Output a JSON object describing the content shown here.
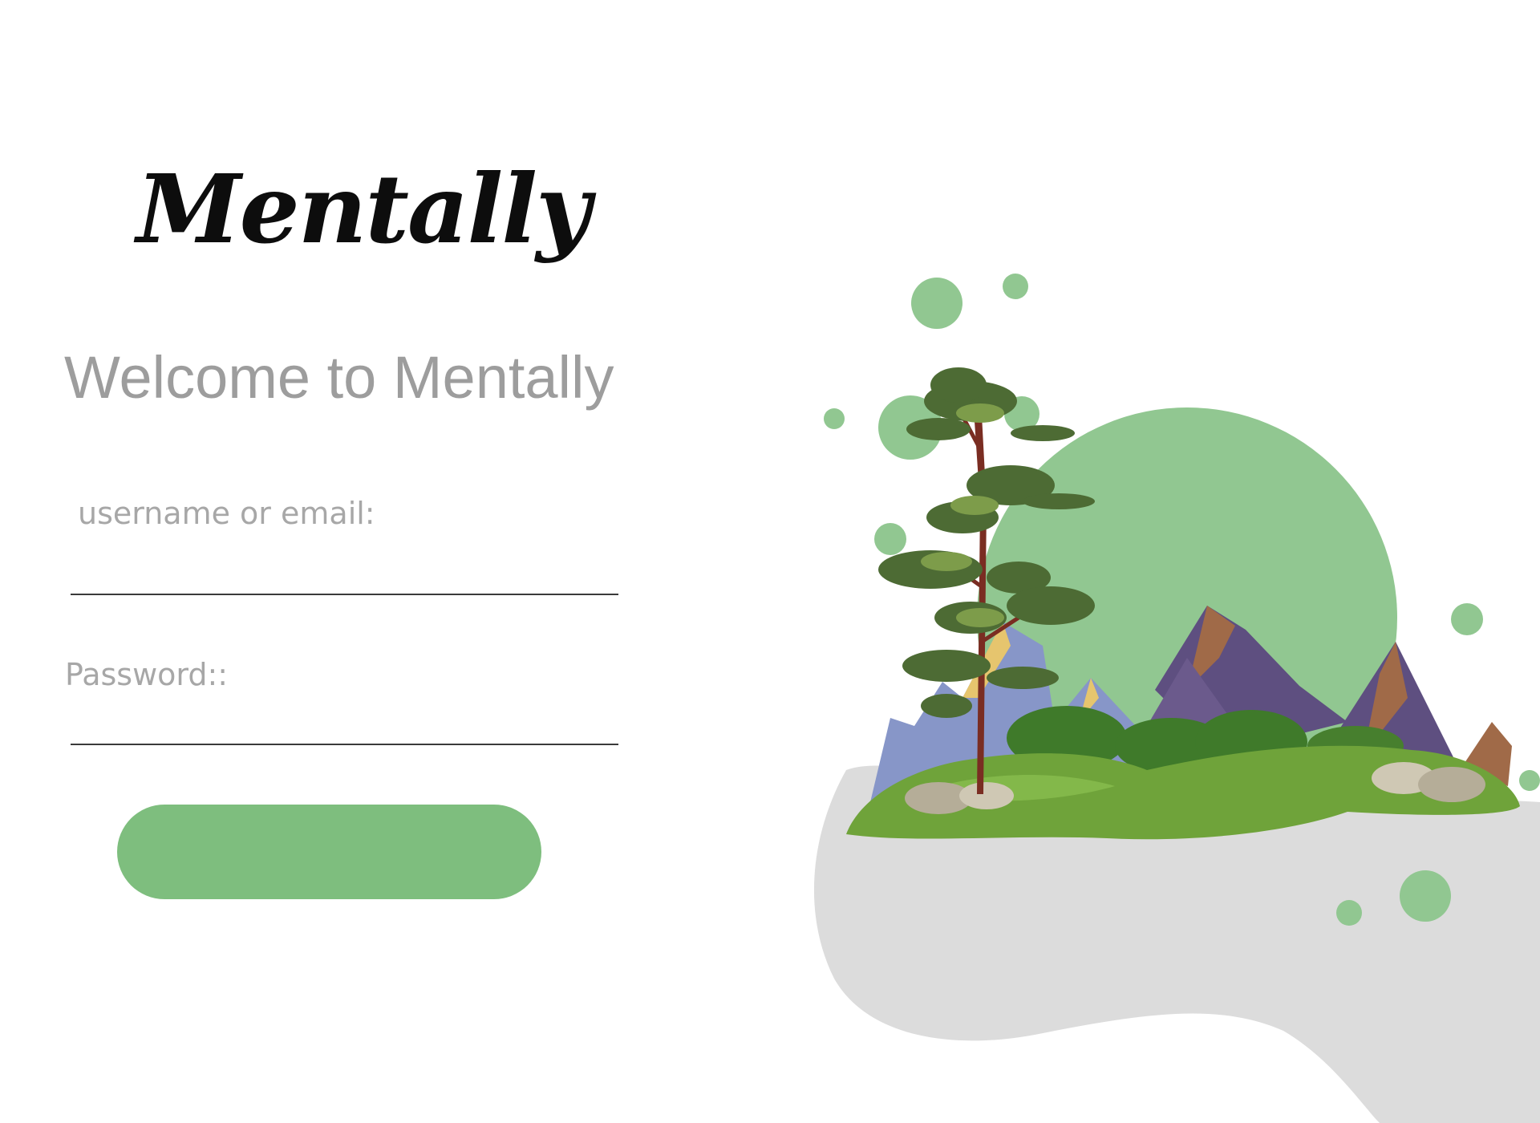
{
  "app": {
    "logo_text": "Mentally"
  },
  "login": {
    "welcome_text": "Welcome to Mentally",
    "username_label": "username or email:",
    "username_value": "",
    "password_label": "Password::",
    "password_value": "",
    "submit_label": ""
  },
  "illustration": {
    "icon": "nature-landscape-illustration",
    "colors": {
      "accent_green": "#7ebe7e",
      "bubble_green": "#91c791",
      "blob_grey": "#dcdcdc",
      "grass": "#6fa33a",
      "mountain_blue": "#8796c8",
      "mountain_purple": "#5e4f80",
      "mountain_brown": "#a06a48"
    }
  }
}
